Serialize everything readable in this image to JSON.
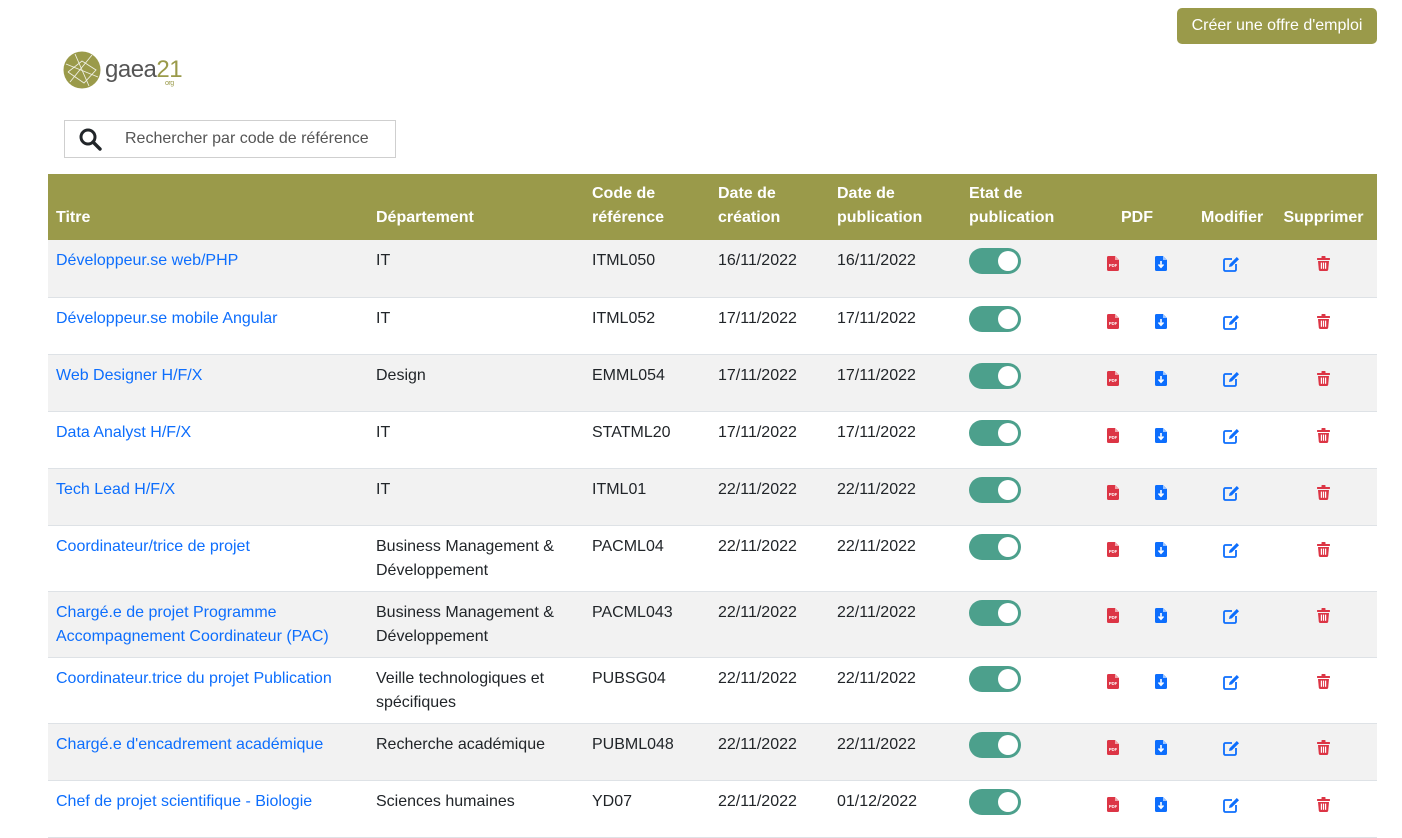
{
  "header": {
    "create_button": "Créer une offre d'emploi",
    "logo": {
      "name": "gaea",
      "number": "21",
      "suffix": "org"
    }
  },
  "search": {
    "placeholder": "Rechercher par code de référence",
    "value": ""
  },
  "colors": {
    "brand": "#9a9a4a",
    "link": "#0d6efd",
    "toggle_on": "#4ca08c",
    "pdf_red": "#dc3545",
    "download_blue": "#0d6efd",
    "edit_blue": "#0d6efd",
    "delete_red": "#dc3545"
  },
  "table": {
    "columns": {
      "title": "Titre",
      "department": "Département",
      "ref_code": "Code de référence",
      "created": "Date de création",
      "published": "Date de publication",
      "status": "Etat de publication",
      "pdf": "PDF",
      "edit": "Modifier",
      "delete": "Supprimer"
    },
    "rows": [
      {
        "title": "Développeur.se web/PHP",
        "department": "IT",
        "ref_code": "ITML050",
        "created": "16/11/2022",
        "published": "16/11/2022",
        "published_state": true
      },
      {
        "title": "Développeur.se mobile Angular",
        "department": "IT",
        "ref_code": "ITML052",
        "created": "17/11/2022",
        "published": "17/11/2022",
        "published_state": true
      },
      {
        "title": "Web Designer H/F/X",
        "department": "Design",
        "ref_code": "EMML054",
        "created": "17/11/2022",
        "published": "17/11/2022",
        "published_state": true
      },
      {
        "title": "Data Analyst H/F/X",
        "department": "IT",
        "ref_code": "STATML20",
        "created": "17/11/2022",
        "published": "17/11/2022",
        "published_state": true
      },
      {
        "title": "Tech Lead H/F/X",
        "department": "IT",
        "ref_code": "ITML01",
        "created": "22/11/2022",
        "published": "22/11/2022",
        "published_state": true
      },
      {
        "title": "Coordinateur/trice de projet",
        "department": "Business Management & Développement",
        "ref_code": "PACML04",
        "created": "22/11/2022",
        "published": "22/11/2022",
        "published_state": true
      },
      {
        "title": "Chargé.e de projet Programme Accompagnement Coordinateur (PAC)",
        "department": "Business Management & Développement",
        "ref_code": "PACML043",
        "created": "22/11/2022",
        "published": "22/11/2022",
        "published_state": true
      },
      {
        "title": "Coordinateur.trice du projet Publication",
        "department": "Veille technologiques et spécifiques",
        "ref_code": "PUBSG04",
        "created": "22/11/2022",
        "published": "22/11/2022",
        "published_state": true
      },
      {
        "title": "Chargé.e d'encadrement académique",
        "department": "Recherche académique",
        "ref_code": "PUBML048",
        "created": "22/11/2022",
        "published": "22/11/2022",
        "published_state": true
      },
      {
        "title": "Chef de projet scientifique - Biologie",
        "department": "Sciences humaines",
        "ref_code": "YD07",
        "created": "22/11/2022",
        "published": "01/12/2022",
        "published_state": true
      }
    ]
  }
}
